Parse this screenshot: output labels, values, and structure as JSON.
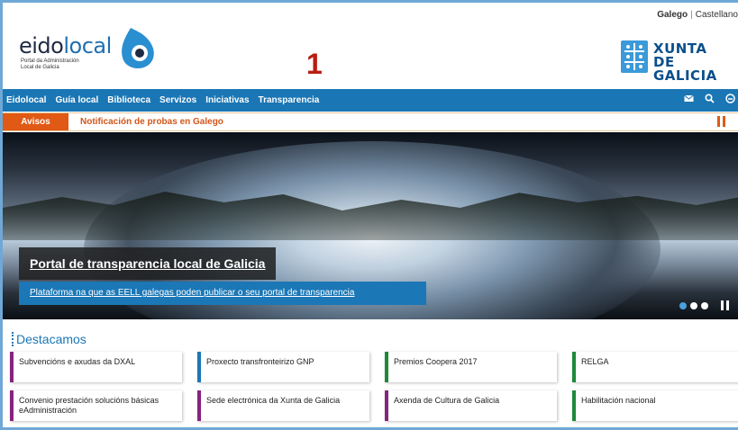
{
  "header": {
    "languages": {
      "active": "Galego",
      "separator": "|",
      "other": "Castellano"
    },
    "logo": {
      "part1": "eido",
      "part2": "local",
      "subtitle_line1": "Portal da Administración",
      "subtitle_line2": "Local de Galicia"
    },
    "annotation": "1",
    "xunta_line1": "XUNTA",
    "xunta_line2": "DE GALICIA"
  },
  "nav": {
    "items": [
      "Eidolocal",
      "Guía local",
      "Biblioteca",
      "Servizos",
      "Iniciativas",
      "Transparencia"
    ],
    "icons": [
      "mail-icon",
      "search-icon",
      "user-icon"
    ]
  },
  "alert": {
    "label": "Avisos",
    "text": "Notificación de probas en Galego"
  },
  "hero": {
    "title": "Portal de transparencia local de Galicia",
    "subtitle": "Plataforma na que as EELL galegas poden publicar o seu portal de transparencia",
    "slides": 3,
    "active_slide": 1
  },
  "featured": {
    "title": "Destacamos",
    "cards": [
      {
        "label": "Subvencións e axudas da DXAL",
        "color": "purple"
      },
      {
        "label": "Proxecto transfronteirizo GNP",
        "color": "blue"
      },
      {
        "label": "Premios Coopera 2017",
        "color": "green"
      },
      {
        "label": "RELGA",
        "color": "green"
      },
      {
        "label": "Convenio prestación solucións básicas eAdministración",
        "color": "purple"
      },
      {
        "label": "Sede electrónica da Xunta de Galicia",
        "color": "purple"
      },
      {
        "label": "Axenda de Cultura de Galicia",
        "color": "purple"
      },
      {
        "label": "Habilitación nacional",
        "color": "green"
      }
    ]
  },
  "colors": {
    "brand": "#1a76b4",
    "alert": "#e05a16",
    "annotation": "#b81e12"
  }
}
